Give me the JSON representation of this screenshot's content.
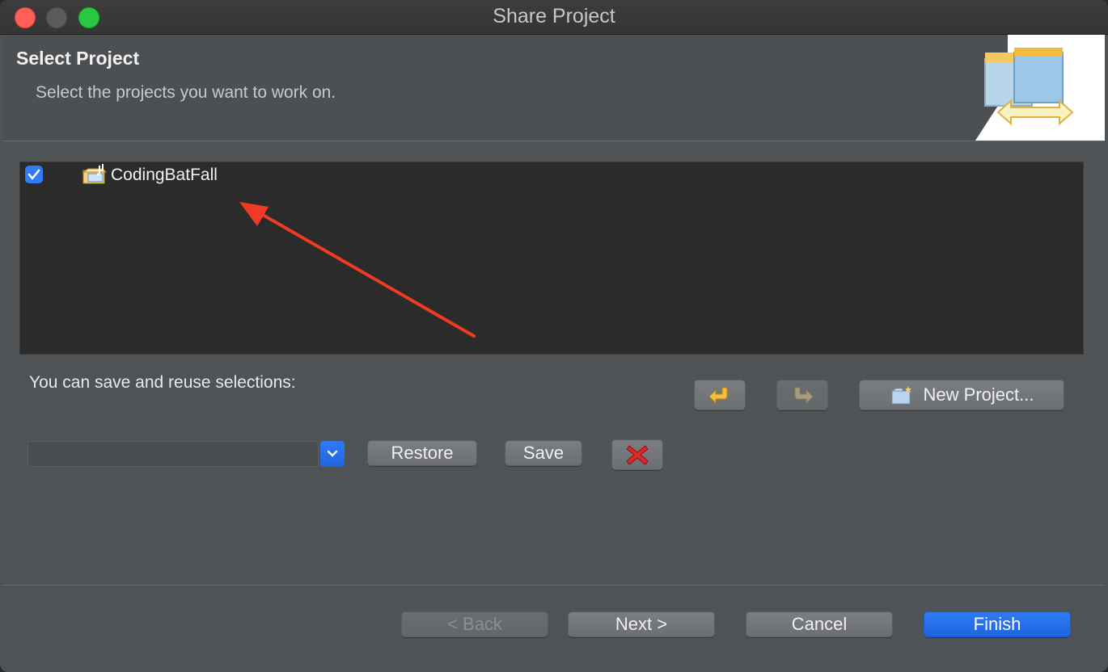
{
  "window": {
    "title": "Share Project"
  },
  "header": {
    "title": "Select Project",
    "subtitle": "Select the projects you want to work on."
  },
  "projects": [
    {
      "name": "CodingBatFall",
      "checked": true
    }
  ],
  "selections": {
    "label": "You can save and reuse selections:",
    "combo_value": "",
    "restore_label": "Restore",
    "save_label": "Save",
    "new_project_label": "New Project..."
  },
  "footer": {
    "back_label": "< Back",
    "next_label": "Next >",
    "cancel_label": "Cancel",
    "finish_label": "Finish"
  },
  "colors": {
    "accent": "#2f7cf6",
    "annotation_arrow": "#f03a24"
  }
}
